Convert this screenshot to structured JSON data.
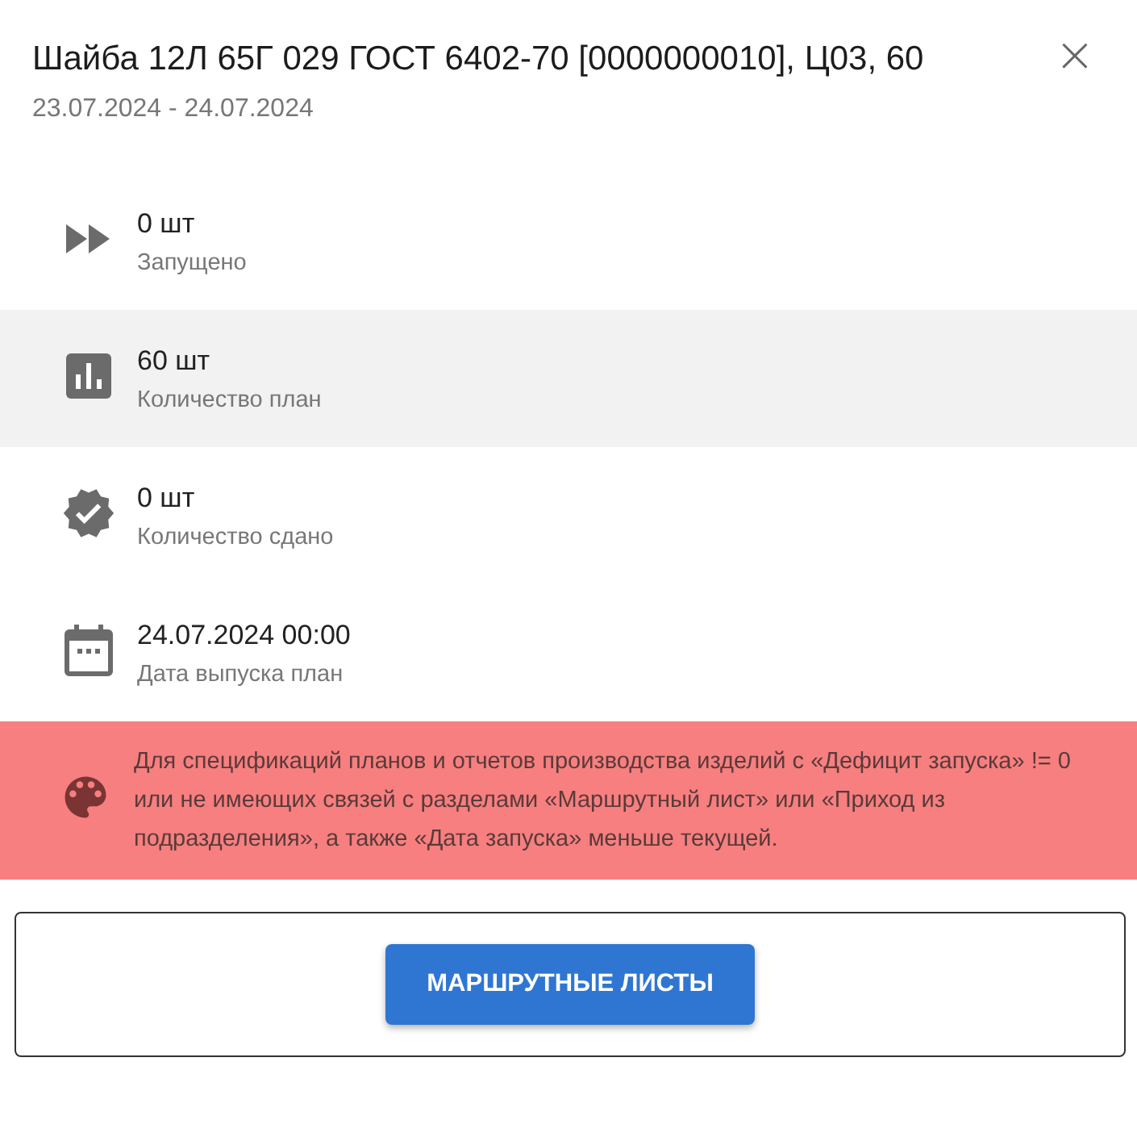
{
  "dialog": {
    "title": "Шайба 12Л 65Г 029 ГОСТ 6402-70 [0000000010], Ц03, 60",
    "subtitle": "23.07.2024 - 24.07.2024",
    "close": "×"
  },
  "rows": [
    {
      "kind": "launched",
      "value": "0 шт",
      "label": "Запущено",
      "highlighted": false
    },
    {
      "kind": "plan",
      "value": "60 шт",
      "label": "Количество план",
      "highlighted": true
    },
    {
      "kind": "done",
      "value": "0 шт",
      "label": "Количество сдано",
      "highlighted": false
    },
    {
      "kind": "date",
      "value": "24.07.2024 00:00",
      "label": "Дата выпуска план",
      "highlighted": false
    }
  ],
  "note": {
    "text": "Для спецификаций планов и отчетов производства изделий с «Дефицит запуска» != 0 или не имеющих связей с разделами «Маршрутный лист» или «Приход из подразделения», а также «Дата запуска» меньше текущей.",
    "color": "#f77f7f"
  },
  "buttons": [
    "МАРШРУТНЫЕ ЛИСТЫ"
  ]
}
